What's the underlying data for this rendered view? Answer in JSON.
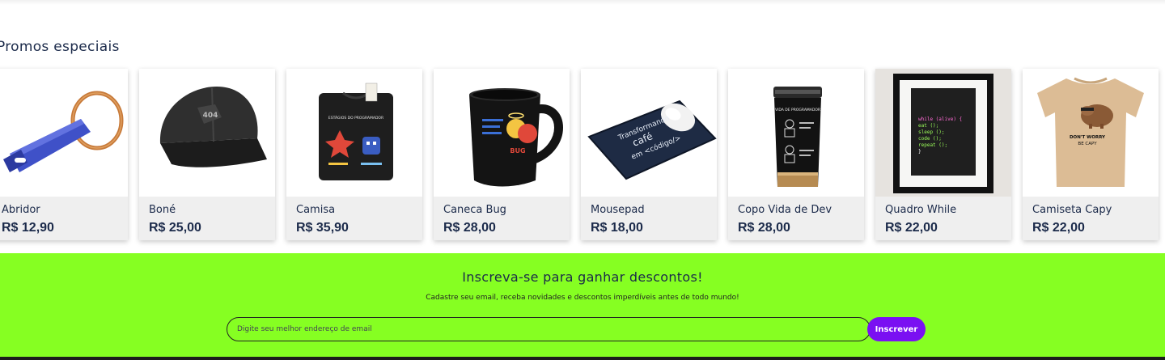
{
  "promos": {
    "title": "Promos especiais",
    "products": [
      {
        "name": "Abridor",
        "price": "R$ 12,90",
        "icon": "keychain-opener-image"
      },
      {
        "name": "Boné",
        "price": "R$ 25,00",
        "icon": "cap-image"
      },
      {
        "name": "Camisa",
        "price": "R$ 35,90",
        "icon": "shirt-image"
      },
      {
        "name": "Caneca Bug",
        "price": "R$ 28,00",
        "icon": "mug-image"
      },
      {
        "name": "Mousepad",
        "price": "R$ 18,00",
        "icon": "mousepad-image"
      },
      {
        "name": "Copo Vida de Dev",
        "price": "R$ 28,00",
        "icon": "tumbler-image"
      },
      {
        "name": "Quadro While",
        "price": "R$ 22,00",
        "icon": "frame-image"
      },
      {
        "name": "Camiseta Capy",
        "price": "R$ 22,00",
        "icon": "capy-tshirt-image"
      }
    ]
  },
  "image_text": {
    "cap_logo": "404",
    "shirt_caption": "ESTÁGIOS DO PROGRAMADOR",
    "mug_text": "BUG",
    "mousepad_line1": "Transformando",
    "mousepad_line2": "café",
    "mousepad_line3": "em <código/>",
    "tumbler_title": "VIDA DE PROGRAMADOR",
    "frame_code": [
      "while (alive) {",
      "  eat ();",
      "  sleep ();",
      "  code ();",
      "  repeat ();",
      "}"
    ],
    "capy_text_1": "DON'T WORRY",
    "capy_text_2": "BE CAPY"
  },
  "newsletter": {
    "title": "Inscreva-se para ganhar descontos!",
    "subtitle": "Cadastre seu email, receba novidades e descontos imperdíveis antes de todo mundo!",
    "placeholder": "Digite seu melhor endereço de email",
    "button": "Inscrever"
  },
  "colors": {
    "navy": "#1b2a4a",
    "newsletter_bg": "#86ff22",
    "button_purple": "#7a10f2"
  }
}
